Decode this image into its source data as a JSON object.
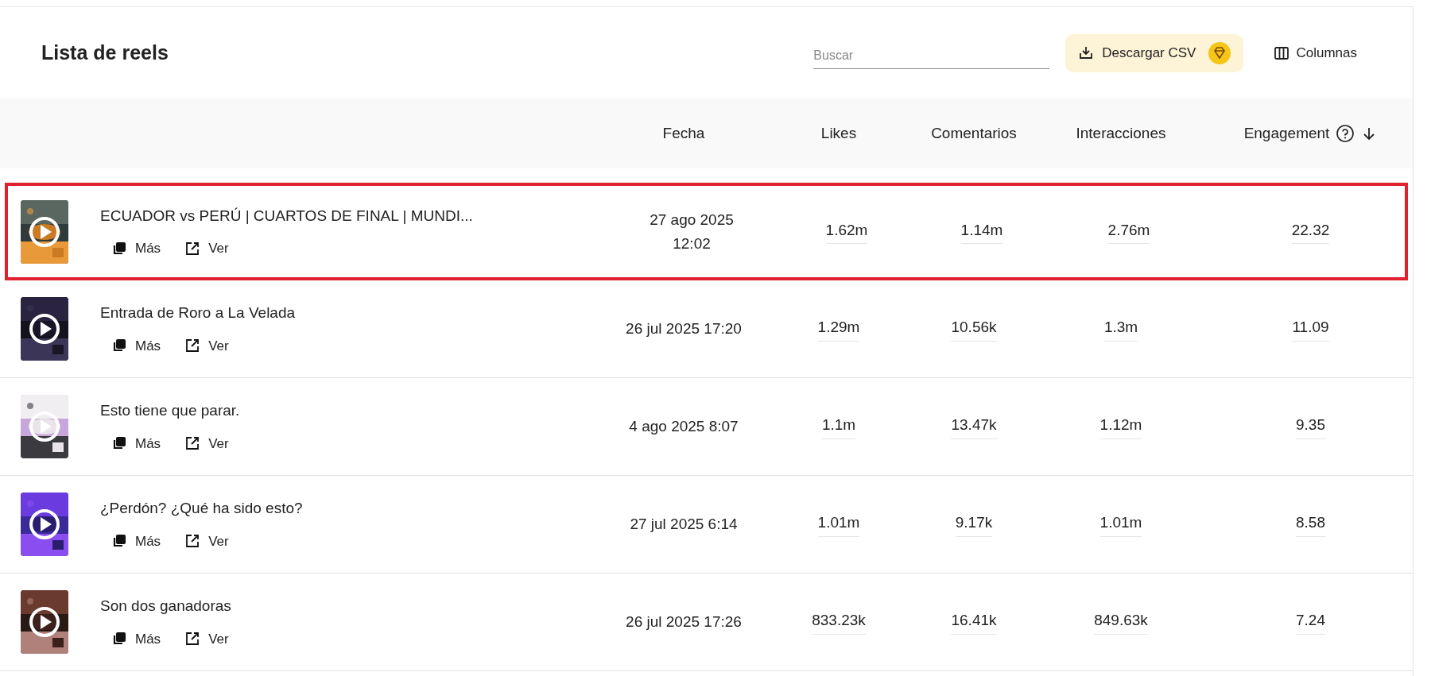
{
  "title": "Lista de reels",
  "search": {
    "placeholder": "Buscar"
  },
  "csv_button": {
    "label": "Descargar CSV"
  },
  "columns_button": {
    "label": "Columnas"
  },
  "table": {
    "columns": [
      {
        "label": "Fecha",
        "help": false,
        "sorted": false
      },
      {
        "label": "Likes",
        "help": false,
        "sorted": false
      },
      {
        "label": "Comentarios",
        "help": false,
        "sorted": false
      },
      {
        "label": "Interacciones",
        "help": false,
        "sorted": false
      },
      {
        "label": "Engagement",
        "help": true,
        "sorted": true
      }
    ],
    "rows": [
      {
        "title": "ECUADOR vs PERÚ | CUARTOS DE FINAL | MUNDI...",
        "actions": [
          "Más",
          "Ver"
        ],
        "date": "27 ago 2025\n12:02",
        "likes": "1.62m",
        "comments": "1.14m",
        "interactions": "2.76m",
        "engagement": "22.32",
        "highlighted": true
      },
      {
        "title": "Entrada de Roro a La Velada",
        "actions": [
          "Más",
          "Ver"
        ],
        "date": "26 jul 2025 17:20",
        "likes": "1.29m",
        "comments": "10.56k",
        "interactions": "1.3m",
        "engagement": "11.09",
        "highlighted": false
      },
      {
        "title": "Esto tiene que parar.",
        "actions": [
          "Más",
          "Ver"
        ],
        "date": "4 ago 2025 8:07",
        "likes": "1.1m",
        "comments": "13.47k",
        "interactions": "1.12m",
        "engagement": "9.35",
        "highlighted": false
      },
      {
        "title": "¿Perdón? ¿Qué ha sido esto?",
        "actions": [
          "Más",
          "Ver"
        ],
        "date": "27 jul 2025 6:14",
        "likes": "1.01m",
        "comments": "9.17k",
        "interactions": "1.01m",
        "engagement": "8.58",
        "highlighted": false
      },
      {
        "title": "Son dos ganadoras",
        "actions": [
          "Más",
          "Ver"
        ],
        "date": "26 jul 2025 17:26",
        "likes": "833.23k",
        "comments": "16.41k",
        "interactions": "849.63k",
        "engagement": "7.24",
        "highlighted": false
      }
    ]
  }
}
